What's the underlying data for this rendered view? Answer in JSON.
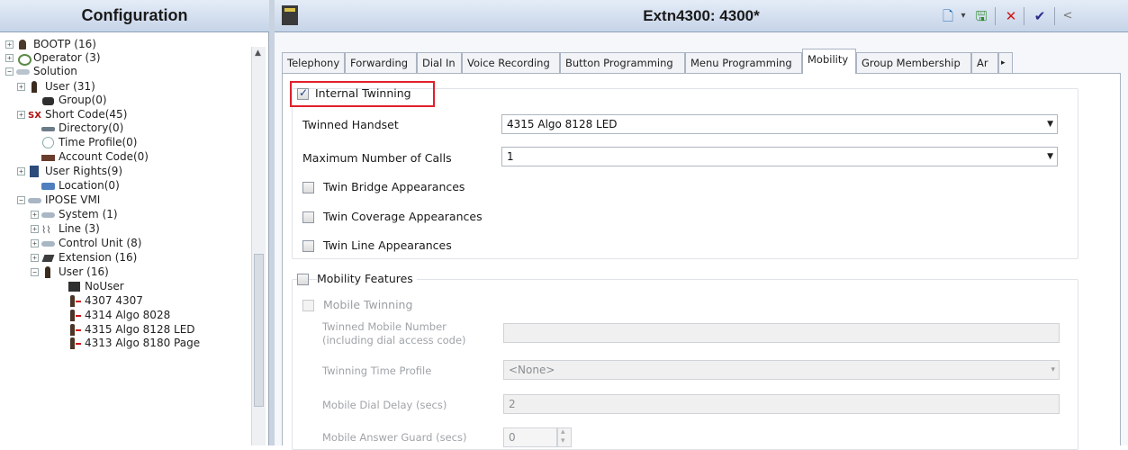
{
  "left_panel": {
    "title": "Configuration",
    "tree": [
      {
        "label": "BOOTP (16)",
        "expander": "+",
        "icon": "bootp-icon"
      },
      {
        "label": "Operator (3)",
        "expander": "+",
        "icon": "operator-icon"
      },
      {
        "label": "Solution",
        "expander": "-",
        "icon": "solution-icon"
      },
      {
        "label": "User (31)",
        "expander": "+",
        "icon": "user-icon"
      },
      {
        "label": "Group(0)",
        "expander": "",
        "icon": "group-icon"
      },
      {
        "label": "Short Code(45)",
        "expander": "+",
        "icon": "short-code-icon"
      },
      {
        "label": "Directory(0)",
        "expander": "",
        "icon": "directory-icon"
      },
      {
        "label": "Time Profile(0)",
        "expander": "",
        "icon": "clock-icon"
      },
      {
        "label": "Account Code(0)",
        "expander": "",
        "icon": "account-code-icon"
      },
      {
        "label": "User Rights(9)",
        "expander": "+",
        "icon": "user-rights-icon"
      },
      {
        "label": "Location(0)",
        "expander": "",
        "icon": "location-icon"
      },
      {
        "label": "IPOSE VMI",
        "expander": "-",
        "icon": "system-icon"
      },
      {
        "label": "System (1)",
        "expander": "+",
        "icon": "system-icon"
      },
      {
        "label": "Line (3)",
        "expander": "+",
        "icon": "line-icon"
      },
      {
        "label": "Control Unit (8)",
        "expander": "+",
        "icon": "control-unit-icon"
      },
      {
        "label": "Extension (16)",
        "expander": "+",
        "icon": "extension-icon"
      },
      {
        "label": "User (16)",
        "expander": "-",
        "icon": "user-icon"
      },
      {
        "label": "NoUser",
        "expander": "",
        "icon": "nouser-icon"
      },
      {
        "label": "4307 4307",
        "expander": "",
        "icon": "phone-user-icon"
      },
      {
        "label": "4314 Algo 8028",
        "expander": "",
        "icon": "phone-user-icon"
      },
      {
        "label": "4315 Algo 8128 LED",
        "expander": "",
        "icon": "phone-user-icon"
      },
      {
        "label": "4313 Algo 8180 Page",
        "expander": "",
        "icon": "phone-user-icon"
      }
    ]
  },
  "editor": {
    "title": "Extn4300: 4300*",
    "toolbar": {
      "new_icon": "new-document-icon",
      "save_icon": "save-icon",
      "delete_icon": "delete-icon",
      "ok_icon": "checkmark-icon",
      "back_icon": "back-arrow-icon",
      "new_glyph": "🗋",
      "drop_glyph": "▾",
      "save_glyph": "🖫",
      "delete_glyph": "✕",
      "ok_glyph": "✔",
      "back_glyph": "<"
    },
    "tabs": [
      {
        "label": "Telephony"
      },
      {
        "label": "Forwarding"
      },
      {
        "label": "Dial In"
      },
      {
        "label": "Voice Recording"
      },
      {
        "label": "Button Programming"
      },
      {
        "label": "Menu Programming"
      },
      {
        "label": "Mobility",
        "active": true
      },
      {
        "label": "Group Membership"
      },
      {
        "label": "Ar"
      }
    ],
    "tab_scroll_glyph": "▸",
    "mobility": {
      "internal_twinning": {
        "label": "Internal Twinning",
        "checked": true
      },
      "twinned_handset": {
        "label": "Twinned Handset",
        "value": "4315 Algo 8128 LED"
      },
      "max_calls": {
        "label": "Maximum Number of Calls",
        "value": "1"
      },
      "twin_bridge": {
        "label": "Twin Bridge Appearances",
        "checked": false
      },
      "twin_coverage": {
        "label": "Twin Coverage Appearances",
        "checked": false
      },
      "twin_line": {
        "label": "Twin Line Appearances",
        "checked": false
      },
      "mobility_features": {
        "label": "Mobility Features",
        "checked": false
      },
      "mobile_twinning": {
        "label": "Mobile Twinning",
        "checked": false
      },
      "twinned_mobile_number": {
        "label_line1": "Twinned Mobile Number",
        "label_line2": "(including dial access code)",
        "value": ""
      },
      "twinning_time_profile": {
        "label": "Twinning Time Profile",
        "value": "<None>"
      },
      "mobile_dial_delay": {
        "label": "Mobile Dial Delay (secs)",
        "value": "2"
      },
      "mobile_answer_guard": {
        "label": "Mobile Answer Guard (secs)",
        "value": "0"
      }
    },
    "dropdown_glyph": "▼"
  }
}
